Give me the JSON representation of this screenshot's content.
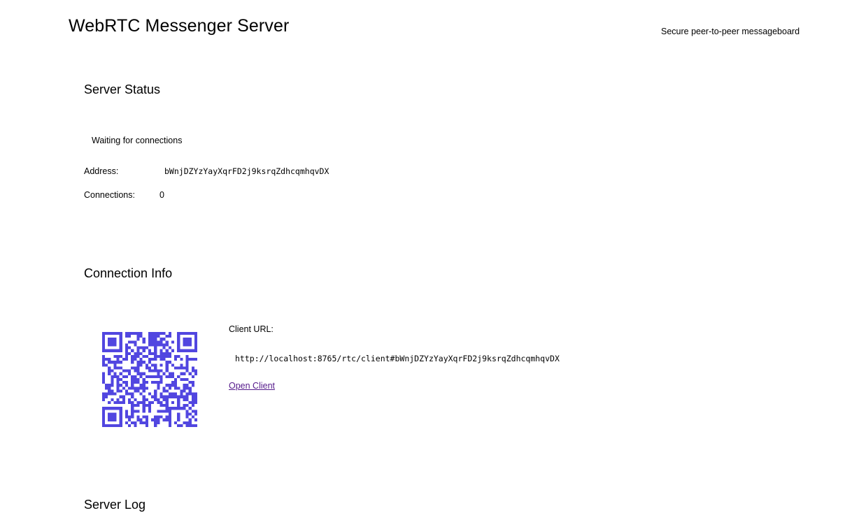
{
  "header": {
    "title": "WebRTC Messenger Server",
    "tagline": "Secure peer-to-peer messageboard"
  },
  "server_status": {
    "heading": "Server Status",
    "status_text": "Waiting for connections",
    "address_label": "Address:",
    "address_value": "bWnjDZYzYayXqrFD2j9ksrqZdhcqmhqvDX",
    "connections_label": "Connections:",
    "connections_value": "0"
  },
  "connection_info": {
    "heading": "Connection Info",
    "qr_icon": "qr-code-icon",
    "qr_color": "#5146e0",
    "client_url_label": "Client URL:",
    "client_url_value": "http://localhost:8765/rtc/client#bWnjDZYzYayXqrFD2j9ksrqZdhcqmhqvDX",
    "open_client_label": "Open Client",
    "link_color": "#551a8b"
  },
  "server_log": {
    "heading": "Server Log"
  }
}
